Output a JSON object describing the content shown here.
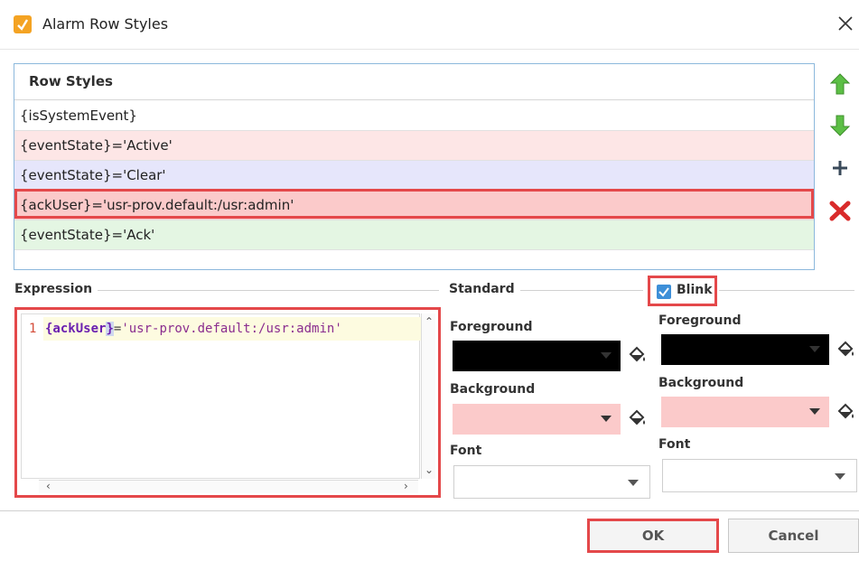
{
  "window": {
    "title": "Alarm Row Styles",
    "app_icon": "ignition-app-icon",
    "close_icon": "close-icon"
  },
  "row_styles": {
    "header": "Row Styles",
    "rows": [
      {
        "expression": "{isSystemEvent}",
        "color": "#ffffff"
      },
      {
        "expression": "{eventState}='Active'",
        "color": "#fde6e6"
      },
      {
        "expression": "{eventState}='Clear'",
        "color": "#e6e6fb"
      },
      {
        "expression": "{ackUser}='usr-prov.default:/usr:admin'",
        "color": "#fbcaca",
        "selected": true
      },
      {
        "expression": "{eventState}='Ack'",
        "color": "#e4f6e3"
      }
    ]
  },
  "side_buttons": {
    "move_up": "arrow-up-icon",
    "move_down": "arrow-down-icon",
    "add": "plus-icon",
    "remove": "delete-x-icon"
  },
  "expression": {
    "label": "Expression",
    "line_number": "1",
    "tokens": {
      "var_open": "{ackUser",
      "var_close": "}",
      "operator": "=",
      "string": "'usr-prov.default:/usr:admin'"
    }
  },
  "standard": {
    "label": "Standard",
    "foreground_label": "Foreground",
    "foreground_color": "#000000",
    "background_label": "Background",
    "background_color": "#fbcaca",
    "font_label": "Font",
    "font_value": ""
  },
  "blink": {
    "label": "Blink",
    "checked": true,
    "foreground_label": "Foreground",
    "foreground_color": "#000000",
    "background_label": "Background",
    "background_color": "#fbcaca",
    "font_label": "Font",
    "font_value": ""
  },
  "footer": {
    "ok_label": "OK",
    "cancel_label": "Cancel"
  },
  "colors": {
    "highlight": "#e4484a",
    "accent_blue": "#3d8fd8",
    "arrow_green": "#4caf3a",
    "delete_red": "#d92b2b"
  }
}
